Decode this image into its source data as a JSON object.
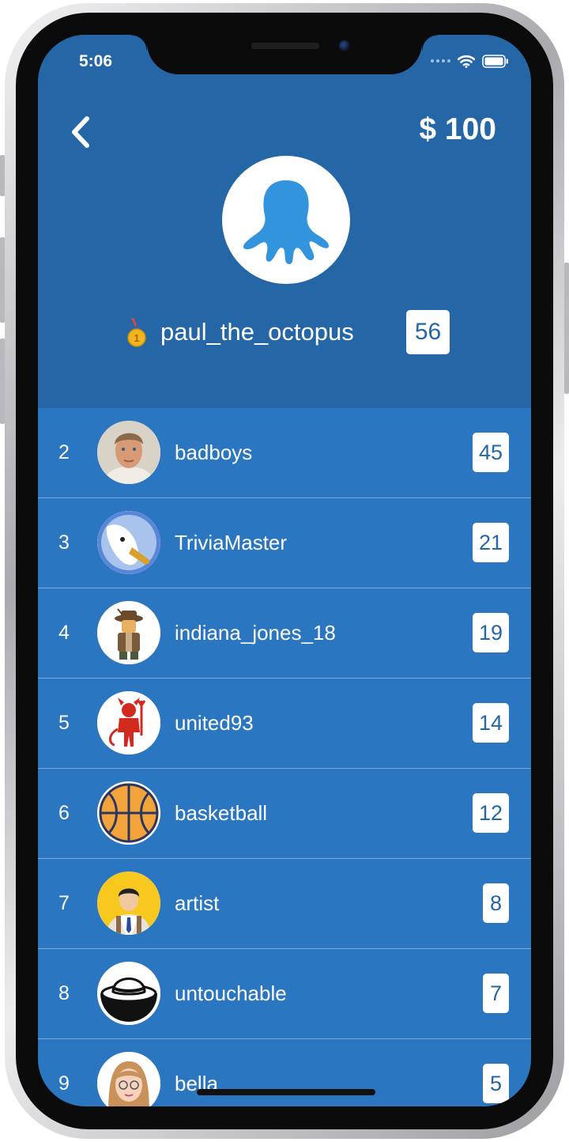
{
  "status_bar": {
    "time": "5:06"
  },
  "header": {
    "back_icon": "chevron-left-icon",
    "balance": "$ 100",
    "leader": {
      "rank_icon": "gold-medal-icon",
      "medal_number": "1",
      "name": "paul_the_octopus",
      "score": "56",
      "avatar": "octopus-icon"
    }
  },
  "leaderboard": [
    {
      "rank": "2",
      "name": "badboys",
      "score": "45",
      "avatar": "portrait-man-icon"
    },
    {
      "rank": "3",
      "name": "TriviaMaster",
      "score": "21",
      "avatar": "seagull-icon"
    },
    {
      "rank": "4",
      "name": "indiana_jones_18",
      "score": "19",
      "avatar": "explorer-figure-icon"
    },
    {
      "rank": "5",
      "name": "united93",
      "score": "14",
      "avatar": "red-devil-icon"
    },
    {
      "rank": "6",
      "name": "basketball",
      "score": "12",
      "avatar": "basketball-icon"
    },
    {
      "rank": "7",
      "name": "artist",
      "score": "8",
      "avatar": "businessman-icon"
    },
    {
      "rank": "8",
      "name": "untouchable",
      "score": "7",
      "avatar": "fedora-hat-icon"
    },
    {
      "rank": "9",
      "name": "bella",
      "score": "5",
      "avatar": "woman-glasses-icon"
    }
  ],
  "colors": {
    "header_bg": "#2466a6",
    "list_bg": "#2a76c0",
    "divider": "#79acdd",
    "text": "#ffffff"
  }
}
